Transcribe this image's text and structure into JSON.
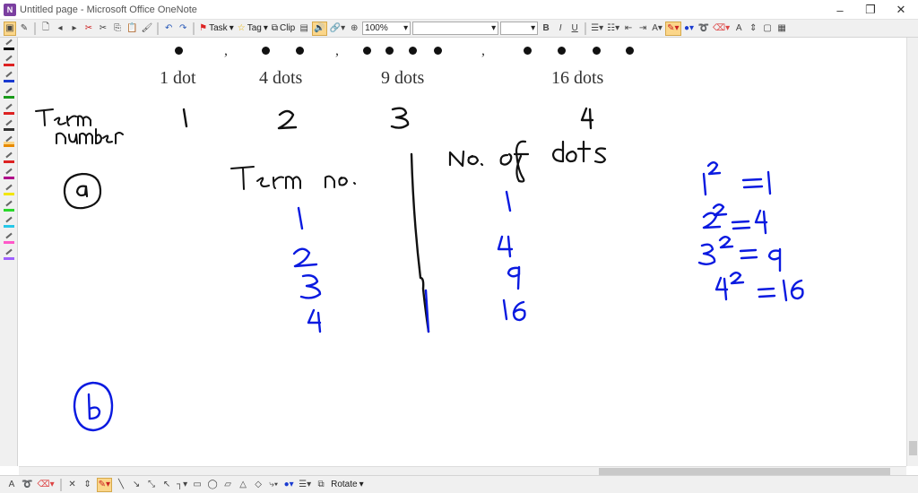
{
  "window": {
    "title": "Untitled page - Microsoft Office OneNote",
    "app_icon_letter": "N",
    "minimize": "–",
    "restore": "❐",
    "close": "✕"
  },
  "toolbar": {
    "task_label": "Task",
    "tag_label": "Tag",
    "clip_label": "Clip",
    "zoom_value": "100%",
    "style_value": "",
    "size_value": "",
    "bold": "B",
    "italic": "I",
    "underline": "U"
  },
  "drawbar": {
    "rotate_label": "Rotate"
  },
  "content": {
    "captions": [
      "1 dot",
      "4 dots",
      "9 dots",
      "16 dots"
    ],
    "ink_term_number": "Term number",
    "ink_term_values": [
      "1",
      "2",
      "3",
      "4"
    ],
    "ink_part_a": "a",
    "ink_table_header_left": "Term no.",
    "ink_table_header_right": "No. of dots",
    "ink_table_left": [
      "1",
      "2",
      "3",
      "4"
    ],
    "ink_table_right": [
      "1",
      "4",
      "9",
      "16"
    ],
    "ink_squares": [
      "1² = 1",
      "2² = 4",
      "3² = 9",
      "4² = 16"
    ],
    "ink_part_b": "b"
  },
  "colors": {
    "ink_black": "#111111",
    "ink_blue": "#0a1ae0",
    "toolbar_bg": "#f0f0f0",
    "highlight": "#fbd68a"
  }
}
